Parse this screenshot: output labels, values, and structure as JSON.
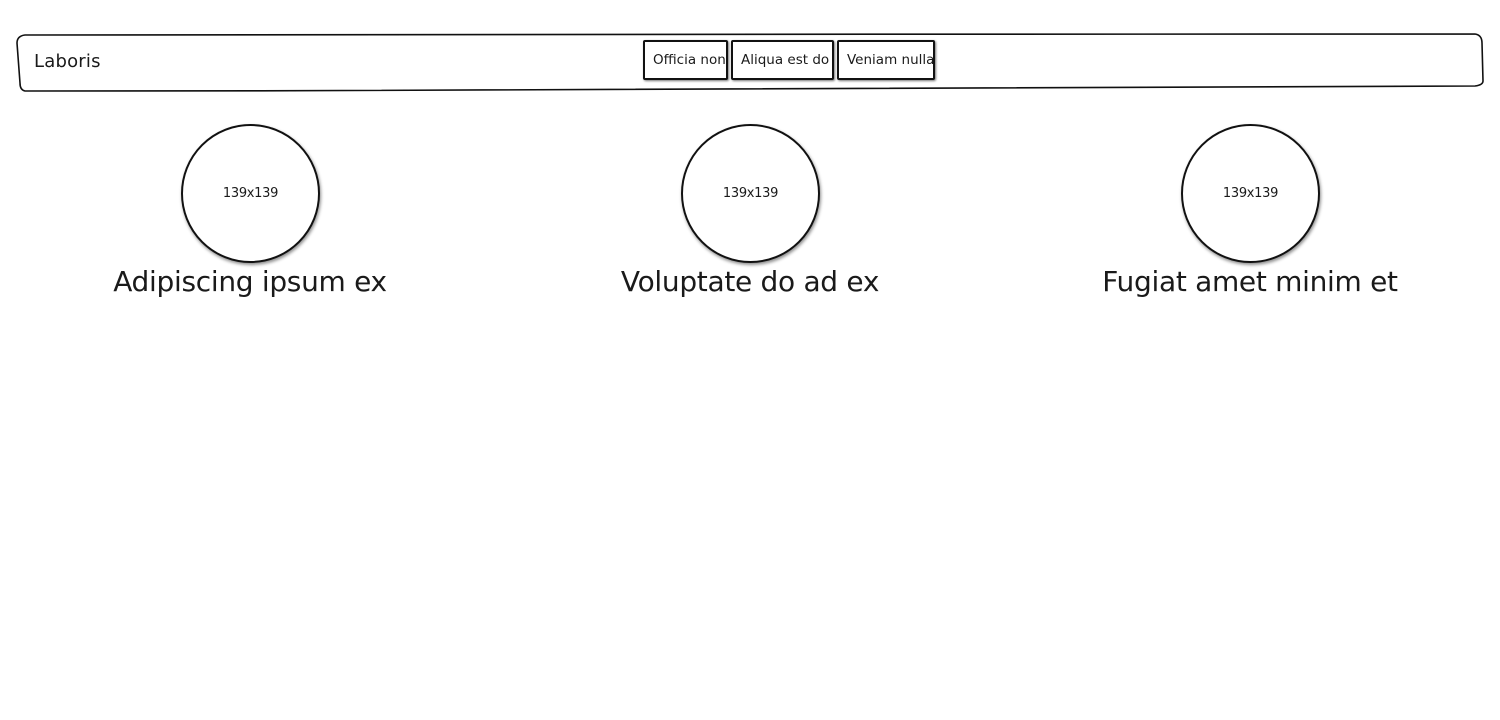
{
  "navbar": {
    "brand": "Laboris",
    "buttons": [
      {
        "label": "Officia non"
      },
      {
        "label": "Aliqua est do"
      },
      {
        "label": "Veniam nulla"
      }
    ]
  },
  "features": [
    {
      "image_label": "139x139",
      "title": "Adipiscing ipsum ex"
    },
    {
      "image_label": "139x139",
      "title": "Voluptate do ad ex"
    },
    {
      "image_label": "139x139",
      "title": "Fugiat amet minim et"
    }
  ]
}
